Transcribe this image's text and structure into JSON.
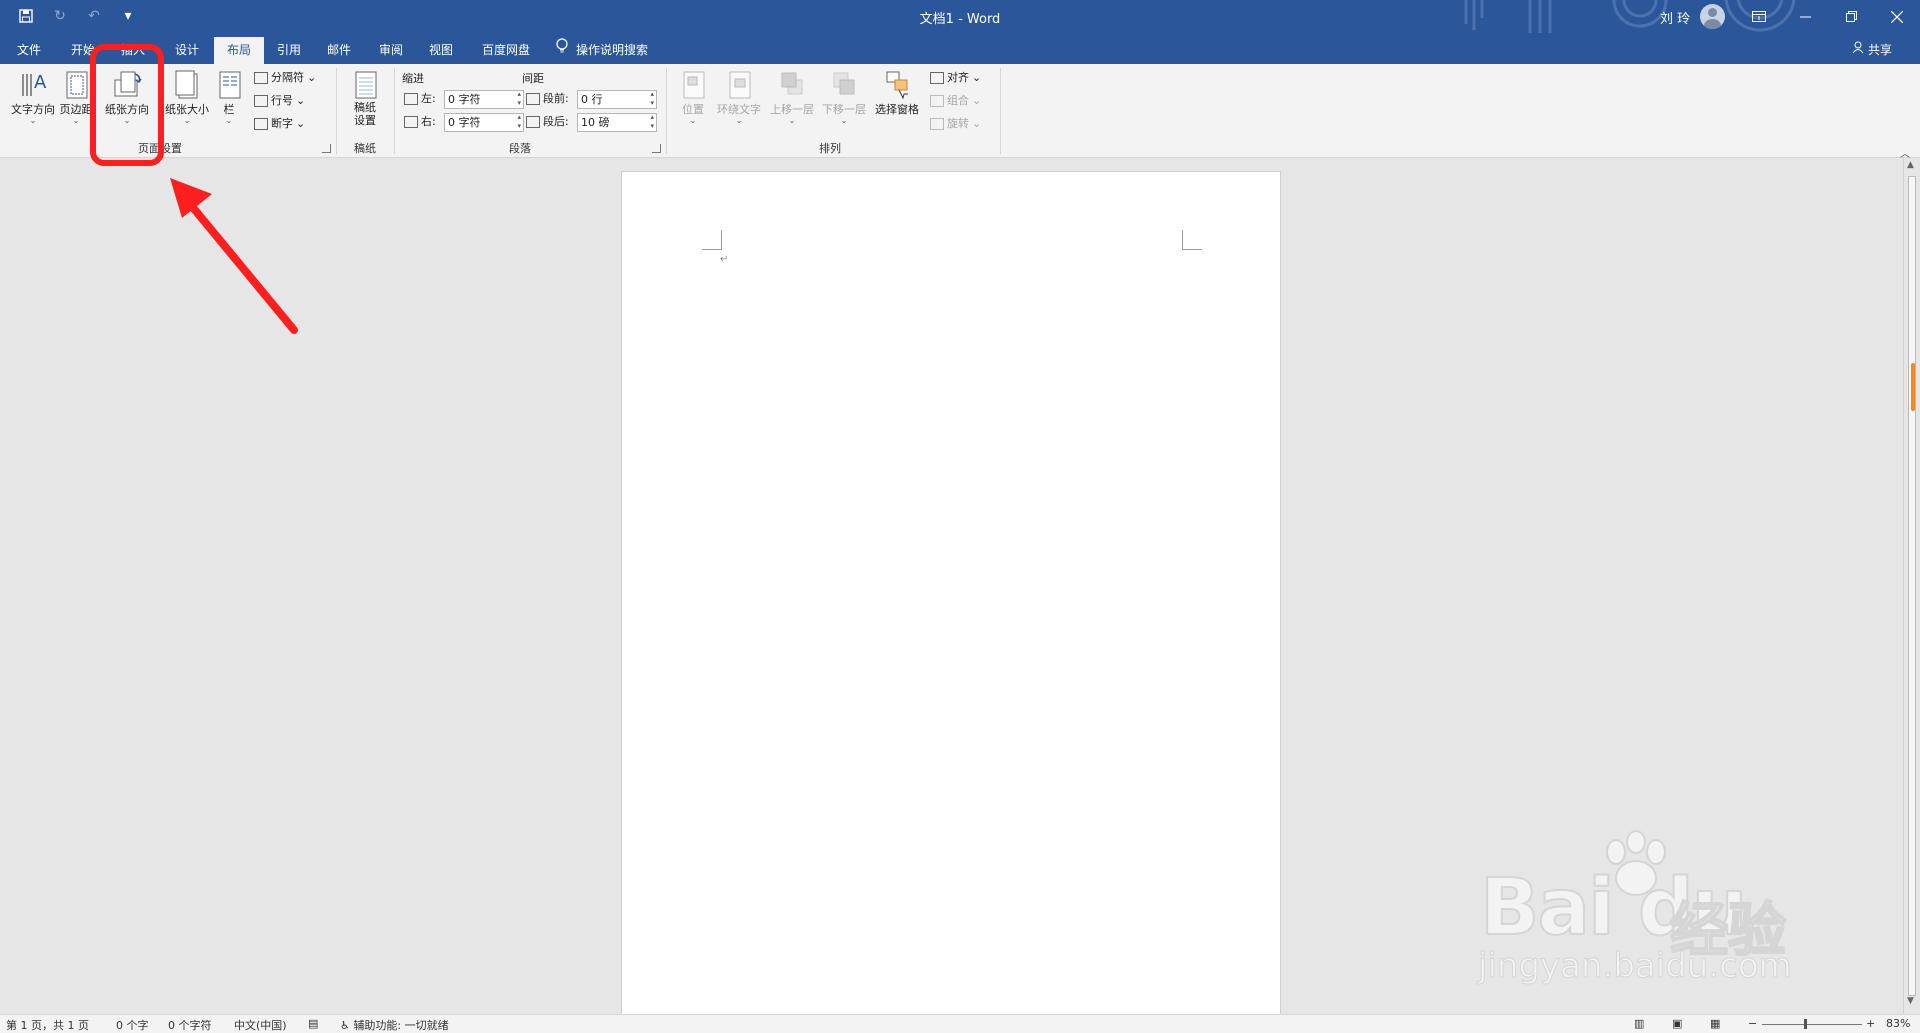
{
  "titlebar": {
    "doc_title": "文档1 - Word",
    "user_name": "刘 玲",
    "qat": [
      "save-icon",
      "redo-icon",
      "undo-icon",
      "customize-icon"
    ],
    "window_controls": [
      "ribbon-display-icon",
      "minimize-icon",
      "restore-icon",
      "close-icon"
    ]
  },
  "tabs": [
    {
      "label": "文件"
    },
    {
      "label": "开始"
    },
    {
      "label": "插入"
    },
    {
      "label": "设计"
    },
    {
      "label": "布局",
      "active": true
    },
    {
      "label": "引用"
    },
    {
      "label": "邮件"
    },
    {
      "label": "审阅"
    },
    {
      "label": "视图"
    },
    {
      "label": "百度网盘"
    }
  ],
  "tell_me": "操作说明搜索",
  "share_label": "共享",
  "ribbon": {
    "page_setup": {
      "label": "页面设置",
      "text_direction": "文字方向",
      "margins": "页边距",
      "orientation": "纸张方向",
      "size": "纸张大小",
      "columns": "栏",
      "breaks": "分隔符",
      "line_numbers": "行号",
      "hyphenation": "断字"
    },
    "draft": {
      "label": "稿纸",
      "button": "稿纸设置"
    },
    "paragraph": {
      "label": "段落",
      "indent_header": "缩进",
      "spacing_header": "间距",
      "left_label": "左:",
      "right_label": "右:",
      "before_label": "段前:",
      "after_label": "段后:",
      "left_value": "0 字符",
      "right_value": "0 字符",
      "before_value": "0 行",
      "after_value": "10 磅"
    },
    "arrange": {
      "label": "排列",
      "position": "位置",
      "wrap_text": "环绕文字",
      "bring_forward": "上移一层",
      "send_backward": "下移一层",
      "selection_pane": "选择窗格",
      "align": "对齐",
      "group": "组合",
      "rotate": "旋转"
    }
  },
  "document": {
    "paragraph_mark": "↵"
  },
  "status": {
    "page": "第 1 页，共 1 页",
    "words": "0 个字",
    "chars": "0 个字符",
    "language": "中文(中国)",
    "accessibility": "辅助功能: 一切就绪",
    "zoom": "83%"
  },
  "watermark": {
    "brand": "Bai du",
    "jingyan": "经验",
    "url": "jingyan.baidu.com"
  },
  "colors": {
    "titlebar": "#2b579a",
    "annotation": "#ff1f1f",
    "scroll_thumb": "#f08a24"
  }
}
